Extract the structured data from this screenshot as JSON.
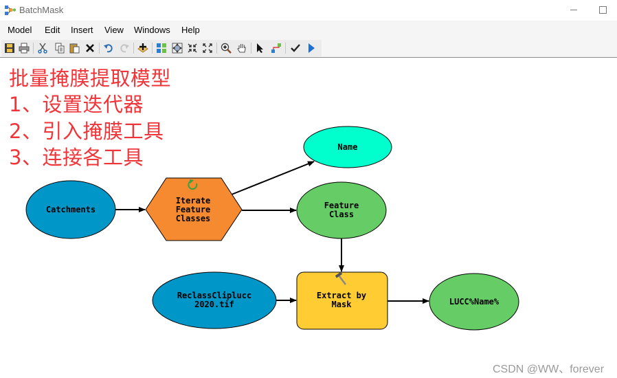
{
  "window": {
    "title": "BatchMask",
    "app_icon": "model-builder-icon",
    "controls": {
      "minimize": "minimize-icon",
      "maximize": "maximize-icon"
    }
  },
  "menubar": {
    "items": [
      {
        "label": "Model"
      },
      {
        "label": "Edit"
      },
      {
        "label": "Insert"
      },
      {
        "label": "View"
      },
      {
        "label": "Windows"
      },
      {
        "label": "Help"
      }
    ]
  },
  "toolbar": {
    "buttons": [
      {
        "name": "save",
        "icon": "save-icon"
      },
      {
        "name": "print",
        "icon": "print-icon"
      },
      {
        "name": "cut",
        "icon": "cut-icon"
      },
      {
        "name": "copy",
        "icon": "copy-icon"
      },
      {
        "name": "paste",
        "icon": "paste-icon"
      },
      {
        "name": "delete",
        "icon": "delete-icon"
      },
      {
        "name": "undo",
        "icon": "undo-icon"
      },
      {
        "name": "redo",
        "icon": "redo-icon"
      },
      {
        "name": "add-data",
        "icon": "add-data-icon"
      },
      {
        "name": "auto-layout",
        "icon": "auto-layout-icon"
      },
      {
        "name": "full-extent",
        "icon": "full-extent-icon"
      },
      {
        "name": "zoom-in-fixed",
        "icon": "fixed-zoom-in-icon"
      },
      {
        "name": "zoom-out-fixed",
        "icon": "fixed-zoom-out-icon"
      },
      {
        "name": "zoom",
        "icon": "zoom-in-icon"
      },
      {
        "name": "pan",
        "icon": "pan-hand-icon"
      },
      {
        "name": "select",
        "icon": "select-arrow-icon"
      },
      {
        "name": "connect",
        "icon": "connect-icon"
      },
      {
        "name": "validate",
        "icon": "validate-check-icon"
      },
      {
        "name": "run",
        "icon": "run-icon"
      }
    ]
  },
  "notes": {
    "color": "#f0353a",
    "lines": [
      "批量掩膜提取模型",
      "1、设置迭代器",
      "2、引入掩膜工具",
      "3、连接各工具"
    ]
  },
  "model": {
    "colors": {
      "input_data": "#0096c8",
      "iterator": "#f58a30",
      "value_output": "#00ffcc",
      "derived_data": "#66cc66",
      "tool": "#ffcc33"
    },
    "nodes": [
      {
        "id": "catchments",
        "type": "input-data",
        "lines": [
          "Catchments"
        ]
      },
      {
        "id": "iterate",
        "type": "iterator",
        "lines": [
          "Iterate",
          "Feature",
          "Classes"
        ],
        "icon": "iterate-loop-icon"
      },
      {
        "id": "name",
        "type": "value-output",
        "lines": [
          "Name"
        ]
      },
      {
        "id": "feature-class",
        "type": "derived-data",
        "lines": [
          "Feature",
          "Class"
        ]
      },
      {
        "id": "reclass",
        "type": "input-data",
        "lines": [
          "ReclassCliplucc",
          "2020.tif"
        ]
      },
      {
        "id": "extract",
        "type": "tool",
        "lines": [
          "Extract by",
          "Mask"
        ],
        "icon": "hammer-tool-icon"
      },
      {
        "id": "output",
        "type": "derived-data",
        "lines": [
          "LUCC%Name%"
        ]
      }
    ],
    "connections": [
      {
        "from": "catchments",
        "to": "iterate"
      },
      {
        "from": "iterate",
        "to": "name"
      },
      {
        "from": "iterate",
        "to": "feature-class"
      },
      {
        "from": "feature-class",
        "to": "extract"
      },
      {
        "from": "reclass",
        "to": "extract"
      },
      {
        "from": "extract",
        "to": "output"
      }
    ]
  },
  "watermark": "CSDN @WW、forever"
}
